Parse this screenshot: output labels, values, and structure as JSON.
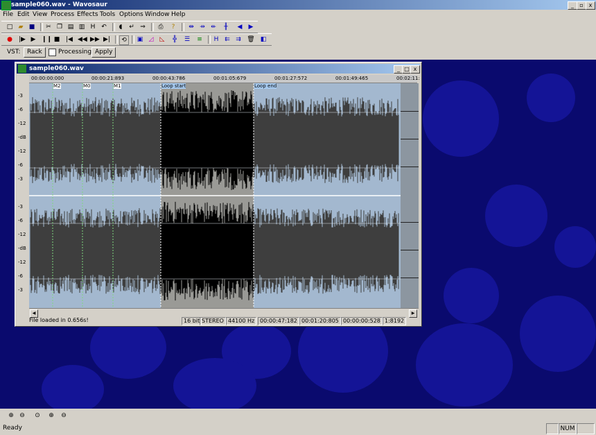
{
  "window": {
    "title": "sample060.wav - Wavosaur",
    "caption_buttons": [
      "_",
      "▫",
      "x"
    ]
  },
  "menu": [
    "File",
    "Edit",
    "View",
    "Process",
    "Effects",
    "Tools",
    "Options",
    "Window",
    "Help"
  ],
  "vst_bar": {
    "vst_label": "VST:",
    "rack_button": "Rack",
    "processing_label": "Processing",
    "apply_button": "Apply"
  },
  "child": {
    "title": "sample060.wav",
    "caption_buttons": [
      "_",
      "□",
      "x"
    ],
    "ruler_ticks": [
      "00:00:00:000",
      "00:00:21:893",
      "00:00:43:786",
      "00:01:05:679",
      "00:01:27:572",
      "00:01:49:465",
      "00:02:11:"
    ],
    "markers": [
      "M2",
      "M0",
      "M1",
      "Loop start",
      "Loop end"
    ],
    "db_scale_top": [
      "-3",
      "-6",
      "-12",
      "-dB",
      "-12",
      "-6",
      "-3"
    ],
    "db_scale_bottom": [
      "-3",
      "-6",
      "-12",
      "-dB",
      "-12",
      "-6",
      "-3"
    ],
    "status": {
      "message": "File loaded in 0.656s!",
      "bits": "16 bit",
      "channels": "STEREO",
      "rate": "44100 Hz",
      "pos1": "00:00:47:182",
      "pos2": "00:01:20:805",
      "pos3": "00:00:00:528",
      "zoom": "1:8192"
    }
  },
  "statusbar": {
    "text": "Ready",
    "num": "NUM"
  },
  "colors": {
    "mdi_background": "#0a0a6e",
    "wave_background": "#a3b8cf",
    "selection": "#9a9a96",
    "marker_line": "#7fd87f"
  }
}
